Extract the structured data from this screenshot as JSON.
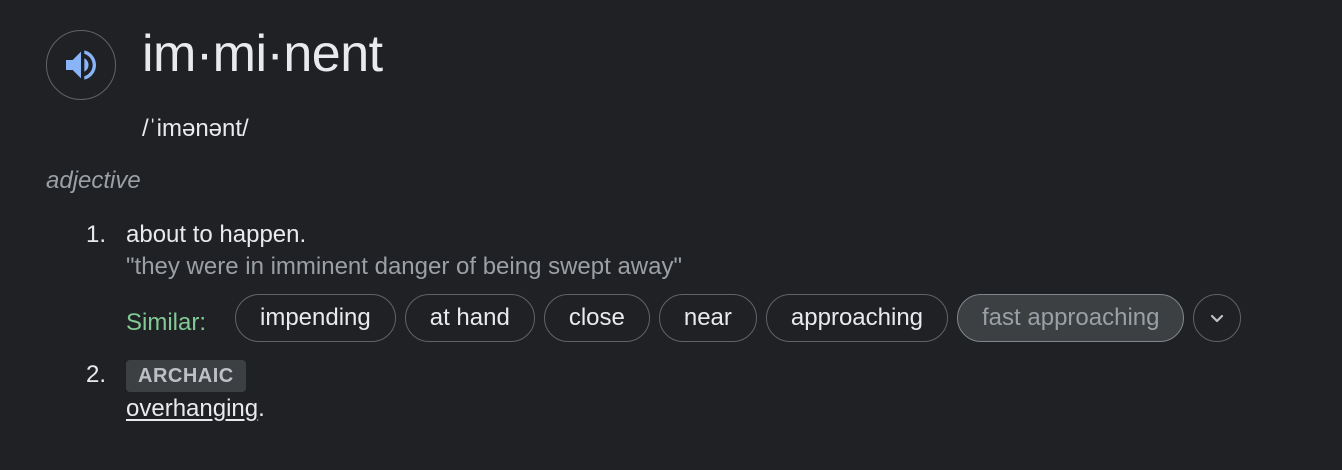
{
  "entry": {
    "headword": "im·mi·nent",
    "phonetic": "/ˈimənənt/",
    "part_of_speech": "adjective",
    "pronounce_icon": "speaker-icon"
  },
  "senses": [
    {
      "number": "1.",
      "definition": "about to happen.",
      "example": "\"they were in imminent danger of being swept away\"",
      "similar_label": "Similar:",
      "similar": [
        "impending",
        "at hand",
        "close",
        "near",
        "approaching",
        "fast approaching"
      ],
      "expand_icon": "chevron-down-icon"
    },
    {
      "number": "2.",
      "label": "ARCHAIC",
      "definition_link": "overhanging",
      "definition_end": "."
    }
  ],
  "colors": {
    "background": "#202124",
    "text": "#e8eaed",
    "muted": "#9aa0a6",
    "similar_label": "#81c995",
    "speaker_icon": "#8ab4f8"
  }
}
